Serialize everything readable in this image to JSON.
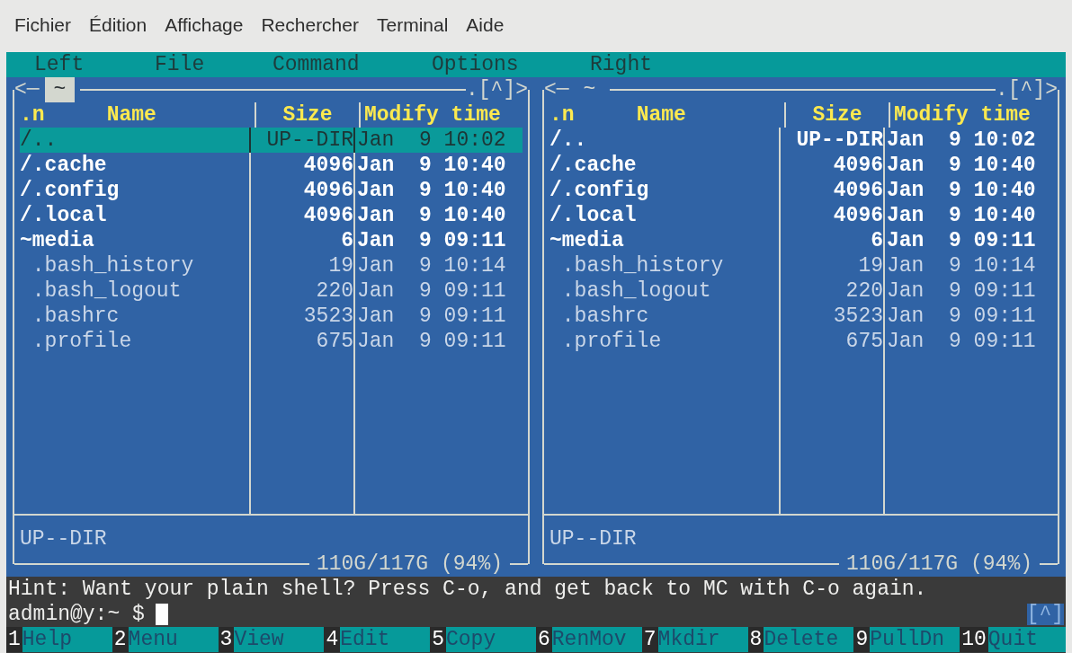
{
  "window_menu": [
    "Fichier",
    "Édition",
    "Affichage",
    "Rechercher",
    "Terminal",
    "Aide"
  ],
  "mc_menu": [
    "Left",
    "File",
    "Command",
    "Options",
    "Right"
  ],
  "panels": [
    {
      "active": true,
      "nav_left": "<─",
      "path": "~",
      "nav_right": ".[^]>",
      "columns": [
        ".n",
        "Name",
        "Size",
        "Modify time"
      ],
      "rows": [
        {
          "name": "/..",
          "size": "UP--DIR",
          "time": "Jan  9 10:02",
          "kind": "dir",
          "selected": true
        },
        {
          "name": "/.cache",
          "size": "4096",
          "time": "Jan  9 10:40",
          "kind": "dir",
          "selected": false
        },
        {
          "name": "/.config",
          "size": "4096",
          "time": "Jan  9 10:40",
          "kind": "dir",
          "selected": false
        },
        {
          "name": "/.local",
          "size": "4096",
          "time": "Jan  9 10:40",
          "kind": "dir",
          "selected": false
        },
        {
          "name": "~media",
          "size": "6",
          "time": "Jan  9 09:11",
          "kind": "dir",
          "selected": false
        },
        {
          "name": " .bash_history",
          "size": "19",
          "time": "Jan  9 10:14",
          "kind": "file",
          "selected": false
        },
        {
          "name": " .bash_logout",
          "size": "220",
          "time": "Jan  9 09:11",
          "kind": "file",
          "selected": false
        },
        {
          "name": " .bashrc",
          "size": "3523",
          "time": "Jan  9 09:11",
          "kind": "file",
          "selected": false
        },
        {
          "name": " .profile",
          "size": "675",
          "time": "Jan  9 09:11",
          "kind": "file",
          "selected": false
        }
      ],
      "status": "UP--DIR",
      "disk": "110G/117G (94%)"
    },
    {
      "active": false,
      "nav_left": "<─",
      "path": "~",
      "nav_right": ".[^]>",
      "columns": [
        ".n",
        "Name",
        "Size",
        "Modify time"
      ],
      "rows": [
        {
          "name": "/..",
          "size": "UP--DIR",
          "time": "Jan  9 10:02",
          "kind": "dir",
          "selected": false
        },
        {
          "name": "/.cache",
          "size": "4096",
          "time": "Jan  9 10:40",
          "kind": "dir",
          "selected": false
        },
        {
          "name": "/.config",
          "size": "4096",
          "time": "Jan  9 10:40",
          "kind": "dir",
          "selected": false
        },
        {
          "name": "/.local",
          "size": "4096",
          "time": "Jan  9 10:40",
          "kind": "dir",
          "selected": false
        },
        {
          "name": "~media",
          "size": "6",
          "time": "Jan  9 09:11",
          "kind": "dir",
          "selected": false
        },
        {
          "name": " .bash_history",
          "size": "19",
          "time": "Jan  9 10:14",
          "kind": "file",
          "selected": false
        },
        {
          "name": " .bash_logout",
          "size": "220",
          "time": "Jan  9 09:11",
          "kind": "file",
          "selected": false
        },
        {
          "name": " .bashrc",
          "size": "3523",
          "time": "Jan  9 09:11",
          "kind": "file",
          "selected": false
        },
        {
          "name": " .profile",
          "size": "675",
          "time": "Jan  9 09:11",
          "kind": "file",
          "selected": false
        }
      ],
      "status": "UP--DIR",
      "disk": "110G/117G (94%)"
    }
  ],
  "hint": "Hint: Want your plain shell? Press C-o, and get back to MC with C-o again.",
  "prompt": "admin@y:~ $",
  "prompt_right": "[^]",
  "function_keys": [
    {
      "number": "1",
      "label": "Help"
    },
    {
      "number": "2",
      "label": "Menu"
    },
    {
      "number": "3",
      "label": "View"
    },
    {
      "number": "4",
      "label": "Edit"
    },
    {
      "number": "5",
      "label": "Copy"
    },
    {
      "number": "6",
      "label": "RenMov"
    },
    {
      "number": "7",
      "label": "Mkdir"
    },
    {
      "number": "8",
      "label": "Delete"
    },
    {
      "number": "9",
      "label": "PullDn"
    },
    {
      "number": "10",
      "label": "Quit"
    }
  ]
}
